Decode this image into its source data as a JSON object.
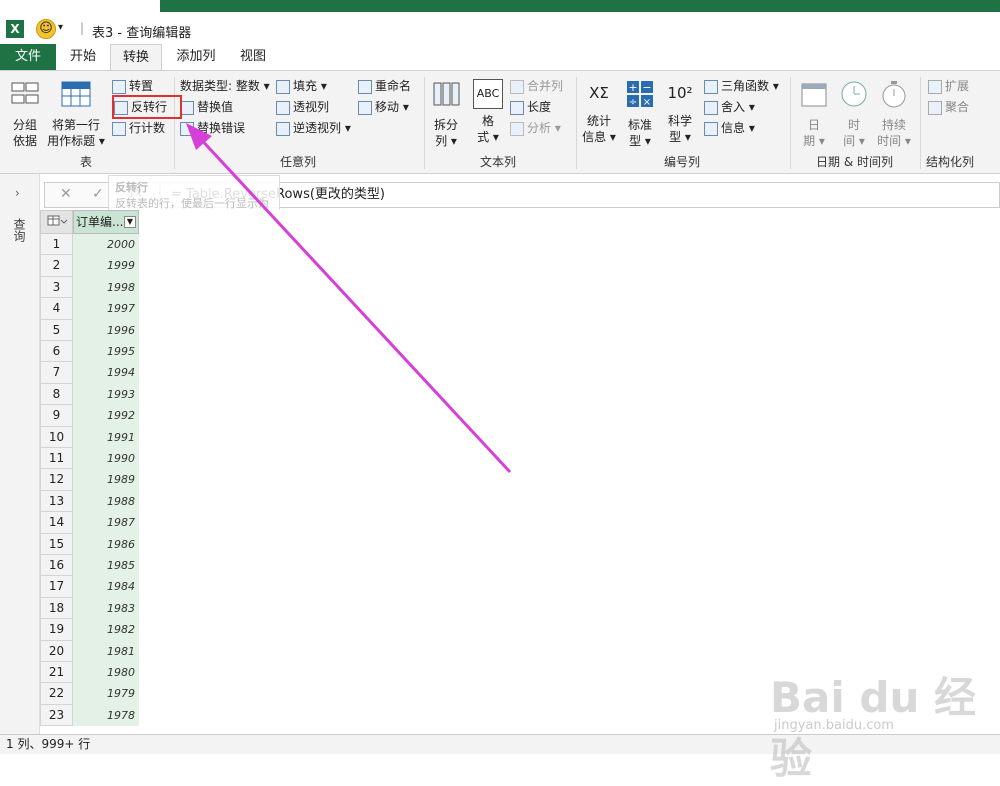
{
  "titlebar": {
    "app_icon": "X",
    "title": "表3 - 查询编辑器",
    "dropdown_glyph": "▾",
    "separator": "|"
  },
  "tabs": [
    {
      "label": "文件"
    },
    {
      "label": "开始"
    },
    {
      "label": "转换"
    },
    {
      "label": "添加列"
    },
    {
      "label": "视图"
    }
  ],
  "ribbon": {
    "table_group": {
      "label": "表",
      "group_by": [
        "分组",
        "依据"
      ],
      "use_first_row": [
        "将第一行",
        "用作标题 ▾"
      ],
      "transpose": "转置",
      "reverse_rows": "反转行",
      "count_rows": "行计数"
    },
    "any_column_group": {
      "label": "任意列",
      "data_type": "数据类型: 整数 ▾",
      "replace_values": "替换值",
      "replace_errors": "替换错误",
      "fill": "填充 ▾",
      "pivot": "透视列",
      "unpivot": "逆透视列 ▾",
      "rename": "重命名",
      "move": "移动 ▾"
    },
    "text_column_group": {
      "label": "文本列",
      "split": [
        "拆分",
        "列 ▾"
      ],
      "format": [
        "格",
        "式 ▾"
      ],
      "merge": "合并列",
      "length": "长度",
      "parse": "分析 ▾",
      "abc_glyph": "ABC"
    },
    "number_column_group": {
      "label": "编号列",
      "statistics": [
        "统计",
        "信息 ▾"
      ],
      "standard": [
        "标准",
        "型 ▾"
      ],
      "scientific": [
        "科学",
        "型 ▾"
      ],
      "trig": "三角函数 ▾",
      "round": "舍入 ▾",
      "info": "信息 ▾",
      "stat_glyph": "XΣ",
      "sci_glyph": "10²"
    },
    "datetime_group": {
      "label": "日期 & 时间列",
      "date": [
        "日",
        "期 ▾"
      ],
      "time": [
        "时",
        "间 ▾"
      ],
      "duration": [
        "持续",
        "时间 ▾"
      ]
    },
    "structured_group": {
      "label": "结构化列",
      "expand": "扩展",
      "aggregate": "聚合"
    }
  },
  "formula_bar": {
    "cancel_glyph": "✕",
    "confirm_glyph": "✓",
    "fx_label": "fx",
    "formula": "= Table.ReverseRows(更改的类型)"
  },
  "tooltip": {
    "title": "反转行",
    "text": "反转表的行，使最后一行显示为第一行。"
  },
  "query_pane": {
    "label": "查询",
    "chevron": "›"
  },
  "grid": {
    "column_header": "订单编...",
    "rows": [
      {
        "n": "1",
        "v": "2000"
      },
      {
        "n": "2",
        "v": "1999"
      },
      {
        "n": "3",
        "v": "1998"
      },
      {
        "n": "4",
        "v": "1997"
      },
      {
        "n": "5",
        "v": "1996"
      },
      {
        "n": "6",
        "v": "1995"
      },
      {
        "n": "7",
        "v": "1994"
      },
      {
        "n": "8",
        "v": "1993"
      },
      {
        "n": "9",
        "v": "1992"
      },
      {
        "n": "10",
        "v": "1991"
      },
      {
        "n": "11",
        "v": "1990"
      },
      {
        "n": "12",
        "v": "1989"
      },
      {
        "n": "13",
        "v": "1988"
      },
      {
        "n": "14",
        "v": "1987"
      },
      {
        "n": "15",
        "v": "1986"
      },
      {
        "n": "16",
        "v": "1985"
      },
      {
        "n": "17",
        "v": "1984"
      },
      {
        "n": "18",
        "v": "1983"
      },
      {
        "n": "19",
        "v": "1982"
      },
      {
        "n": "20",
        "v": "1981"
      },
      {
        "n": "21",
        "v": "1980"
      },
      {
        "n": "22",
        "v": "1979"
      },
      {
        "n": "23",
        "v": "1978"
      }
    ]
  },
  "status": {
    "text": "1 列、999+ 行"
  },
  "watermark": {
    "brand": "Bai du 经验",
    "url": "jingyan.baidu.com"
  },
  "colors": {
    "excel_green": "#1f7244",
    "column_fill": "#e3f1e7",
    "annotation_magenta": "#d63fd9",
    "highlight_red": "#e03030"
  }
}
